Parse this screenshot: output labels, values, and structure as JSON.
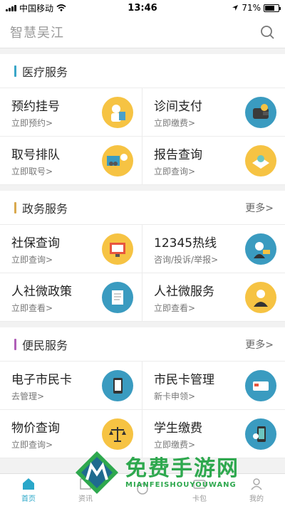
{
  "status_bar": {
    "carrier": "中国移动",
    "time": "13:46",
    "battery": "71%"
  },
  "search": {
    "title": "智慧吴江"
  },
  "sections": [
    {
      "title": "医疗服务",
      "accent": "#3aa6c8",
      "more": "",
      "items": [
        {
          "title": "预约挂号",
          "sub": "立即预约>",
          "icon": "doctor-icon",
          "icon_bg": "#f6c343"
        },
        {
          "title": "诊间支付",
          "sub": "立即缴费>",
          "icon": "wallet-icon",
          "icon_bg": "#3a9bc0"
        },
        {
          "title": "取号排队",
          "sub": "立即取号>",
          "icon": "queue-icon",
          "icon_bg": "#f6c343"
        },
        {
          "title": "报告查询",
          "sub": "立即查询>",
          "icon": "report-icon",
          "icon_bg": "#f6c343"
        }
      ]
    },
    {
      "title": "政务服务",
      "accent": "#d9a94e",
      "more": "更多>",
      "items": [
        {
          "title": "社保查询",
          "sub": "立即查询>",
          "icon": "social-security-icon",
          "icon_bg": "#f6c343"
        },
        {
          "title": "12345热线",
          "sub": "咨询/投诉/举报>",
          "icon": "hotline-icon",
          "icon_bg": "#3a9bc0"
        },
        {
          "title": "人社微政策",
          "sub": "立即查看>",
          "icon": "policy-icon",
          "icon_bg": "#3a9bc0"
        },
        {
          "title": "人社微服务",
          "sub": "立即查看>",
          "icon": "service-icon",
          "icon_bg": "#f6c343"
        }
      ]
    },
    {
      "title": "便民服务",
      "accent": "#b05fb8",
      "more": "更多>",
      "items": [
        {
          "title": "电子市民卡",
          "sub": "去管理>",
          "icon": "phone-card-icon",
          "icon_bg": "#3a9bc0"
        },
        {
          "title": "市民卡管理",
          "sub": "新卡申领>",
          "icon": "citizen-card-icon",
          "icon_bg": "#3a9bc0"
        },
        {
          "title": "物价查询",
          "sub": "立即查询>",
          "icon": "scale-icon",
          "icon_bg": "#f6c343"
        },
        {
          "title": "学生缴费",
          "sub": "立即缴费>",
          "icon": "student-pay-icon",
          "icon_bg": "#3a9bc0"
        }
      ]
    }
  ],
  "tabs": [
    {
      "label": "首页",
      "icon": "home-icon",
      "active": true
    },
    {
      "label": "资讯",
      "icon": "news-icon",
      "active": false
    },
    {
      "label": "",
      "icon": "center-icon",
      "active": false
    },
    {
      "label": "卡包",
      "icon": "card-icon",
      "active": false
    },
    {
      "label": "我的",
      "icon": "user-icon",
      "active": false
    }
  ],
  "watermark": {
    "cn": "免费手游网",
    "en": "MIANFEISHOUYOUWANG"
  }
}
